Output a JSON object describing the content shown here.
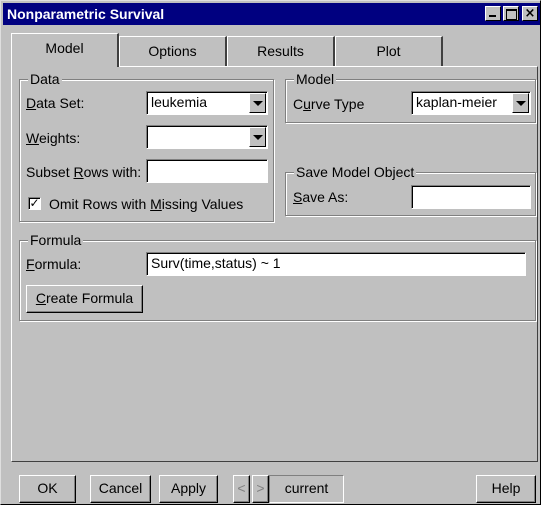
{
  "window": {
    "title": "Nonparametric Survival"
  },
  "tabs": [
    {
      "label": "Model",
      "active": true
    },
    {
      "label": "Options",
      "active": false
    },
    {
      "label": "Results",
      "active": false
    },
    {
      "label": "Plot",
      "active": false
    }
  ],
  "data_group": {
    "legend": "Data",
    "dataset": {
      "label_accel": "D",
      "label_rest": "ata Set:",
      "value": "leukemia"
    },
    "weights": {
      "label_accel": "W",
      "label_rest": "eights:",
      "value": ""
    },
    "subset": {
      "label_pre": "Subset ",
      "label_accel": "R",
      "label_rest": "ows with:",
      "value": ""
    },
    "omit": {
      "checked": true,
      "check_glyph": "✓",
      "label_pre": "Omit Rows with ",
      "label_accel": "M",
      "label_rest": "issing Values"
    }
  },
  "model_group": {
    "legend": "Model",
    "curve_type": {
      "label_pre": "C",
      "label_accel": "u",
      "label_rest": "rve Type",
      "value": "kaplan-meier"
    }
  },
  "save_group": {
    "legend": "Save Model Object",
    "save_as": {
      "label_accel": "S",
      "label_rest": "ave As:",
      "value": ""
    }
  },
  "formula_group": {
    "legend": "Formula",
    "formula": {
      "label_accel": "F",
      "label_rest": "ormula:",
      "value": "Surv(time,status) ~ 1"
    },
    "create_button": {
      "label_accel": "C",
      "label_rest": "reate Formula"
    }
  },
  "footer": {
    "ok": "OK",
    "cancel": "Cancel",
    "apply": "Apply",
    "prev": "<",
    "next": ">",
    "current": "current",
    "help": "Help"
  }
}
